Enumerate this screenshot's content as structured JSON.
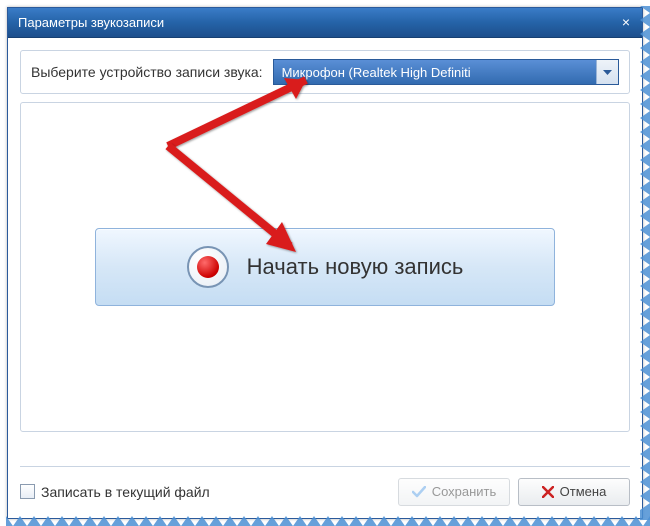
{
  "window": {
    "title": "Параметры звукозаписи"
  },
  "device": {
    "label": "Выберите устройство записи звука:",
    "selected": "Микрофон (Realtek High Definiti"
  },
  "record": {
    "label": "Начать новую запись"
  },
  "footer": {
    "checkbox_label": "Записать в текущий файл",
    "save_label": "Сохранить",
    "cancel_label": "Отмена"
  },
  "colors": {
    "titlebar": "#2563a8",
    "dropdown": "#326bb0",
    "annotation": "#d91c1c"
  }
}
